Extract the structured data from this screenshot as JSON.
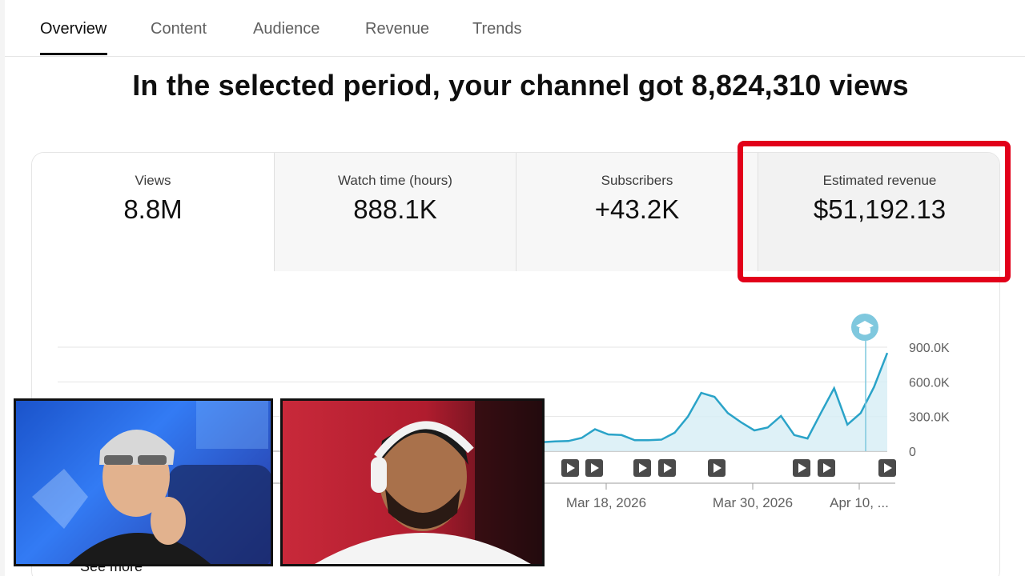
{
  "tabs": [
    {
      "label": "Overview",
      "active": true
    },
    {
      "label": "Content",
      "active": false
    },
    {
      "label": "Audience",
      "active": false
    },
    {
      "label": "Revenue",
      "active": false
    },
    {
      "label": "Trends",
      "active": false
    }
  ],
  "headline": "In the selected period, your channel got 8,824,310 views",
  "metrics": [
    {
      "label": "Views",
      "value": "8.8M"
    },
    {
      "label": "Watch time (hours)",
      "value": "888.1K"
    },
    {
      "label": "Subscribers",
      "value": "+43.2K"
    },
    {
      "label": "Estimated revenue",
      "value": "$51,192.13"
    }
  ],
  "highlight_color": "#e2001a",
  "chart_data": {
    "type": "area",
    "y_ticks": [
      "900.0K",
      "600.0K",
      "300.0K",
      "0"
    ],
    "x_tick_labels": [
      "Mar 18, 2026",
      "Mar 30, 2026",
      "Apr 10, ..."
    ],
    "ylim": [
      0,
      900000
    ],
    "series_color": "#2aa3c8",
    "visible_points": [
      [
        0,
        75000
      ],
      [
        1,
        78000
      ],
      [
        2,
        85000
      ],
      [
        3,
        88000
      ],
      [
        4,
        115000
      ],
      [
        5,
        190000
      ],
      [
        6,
        145000
      ],
      [
        7,
        140000
      ],
      [
        8,
        95000
      ],
      [
        9,
        95000
      ],
      [
        10,
        100000
      ],
      [
        11,
        160000
      ],
      [
        12,
        300000
      ],
      [
        13,
        505000
      ],
      [
        14,
        470000
      ],
      [
        15,
        330000
      ],
      [
        16,
        250000
      ],
      [
        17,
        180000
      ],
      [
        18,
        205000
      ],
      [
        19,
        305000
      ],
      [
        20,
        140000
      ],
      [
        21,
        110000
      ],
      [
        22,
        330000
      ],
      [
        23,
        545000
      ],
      [
        24,
        230000
      ],
      [
        25,
        330000
      ],
      [
        26,
        555000
      ],
      [
        27,
        850000
      ]
    ],
    "marker_icon": "graduation-cap-icon"
  },
  "see_more": "See more"
}
